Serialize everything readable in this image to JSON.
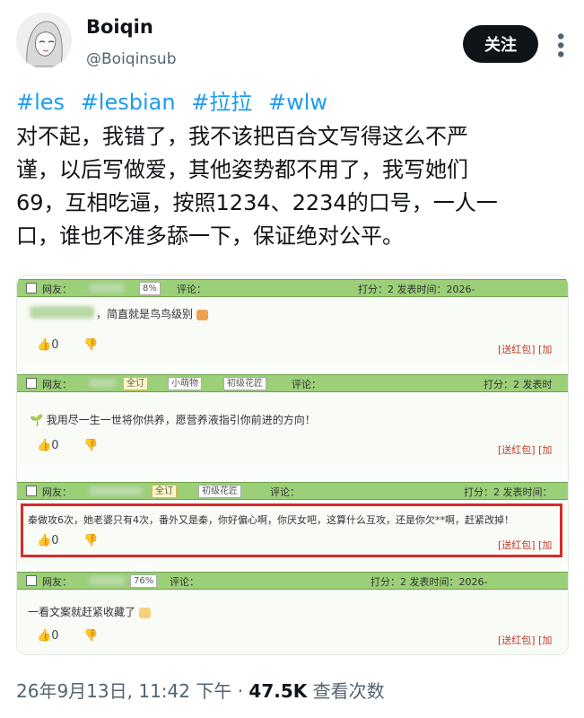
{
  "user": {
    "name": "Boiqin",
    "handle": "@Boiqinsub",
    "follow_label": "关注",
    "more_icon": "more-dots-icon"
  },
  "tags": [
    "#les",
    "#lesbian",
    "#拉拉",
    "#wlw"
  ],
  "body_lines": [
    "对不起，我错了，我不该把百合文写得这么不严",
    "谨，以后写做爱，其他姿势都不用了，我写她们",
    "69，互相吃逼，按照1234、2234的口号，一人一",
    "口，谁也不准多舔一下，保证绝对公平。"
  ],
  "comments": [
    {
      "header": {
        "netizen": "网友：",
        "badge1": "8%",
        "review": "评论：",
        "score": "打分：2  发表时间：2026-",
        "badges": []
      },
      "text": "，简直就是鸟鸟级别",
      "likes": "0",
      "red_packet": "[送红包]  [加"
    },
    {
      "header": {
        "netizen": "网友：",
        "badges": [
          "全订",
          "小萌物",
          "初级花匠"
        ],
        "review": "评论：",
        "score": "打分：2  发表时"
      },
      "text": "我用尽一生一世将你供养，愿营养液指引你前进的方向！",
      "likes": "0",
      "red_packet": "[送红包]  [加"
    },
    {
      "header": {
        "netizen": "网友：",
        "badges": [
          "全订",
          "初级花匠"
        ],
        "review": "评论：",
        "score": "打分：2  发表时间："
      },
      "text": "秦做攻6次，她老婆只有4次，番外又是秦，你好偏心啊，你厌女吧，这算什么互攻，还是你欠**啊，赶紧改掉！",
      "likes": "0",
      "red_packet": "[送红包]  [加"
    },
    {
      "header": {
        "netizen": "网友：",
        "badge1": "76%",
        "review": "评论：",
        "score": "打分：2  发表时间：2026-"
      },
      "text": "一看文案就赶紧收藏了",
      "likes": "0",
      "red_packet": "[送红包]  [加"
    }
  ],
  "footer": {
    "date": "26年9月13日",
    "time": "11:42 下午",
    "dot": "·",
    "views": "47.5K",
    "views_label": "查看次数"
  }
}
